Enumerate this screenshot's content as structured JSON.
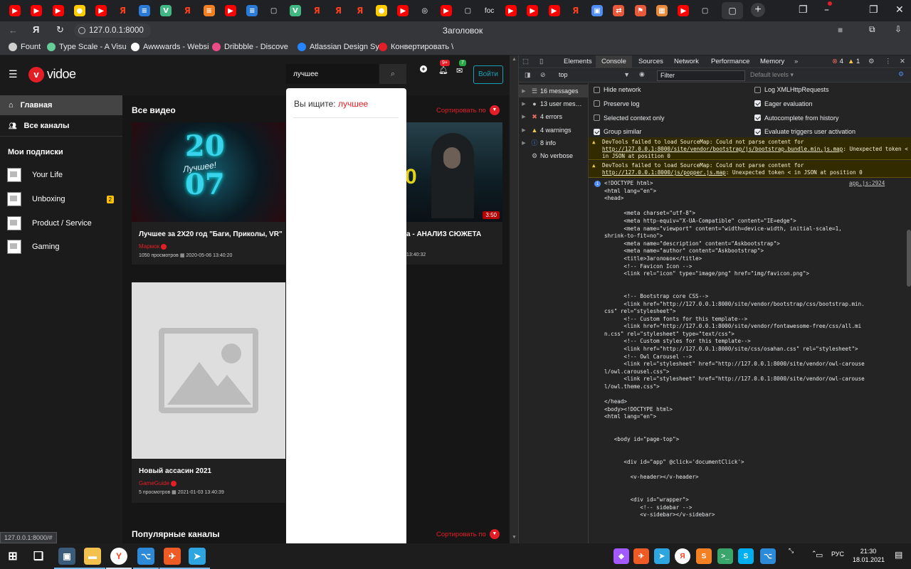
{
  "browser": {
    "window_title": "Заголовок",
    "url": "127.0.0.1:8000",
    "tabs": [
      {
        "icon": "youtube-icon",
        "color": "#ff0000"
      },
      {
        "icon": "youtube-icon",
        "color": "#ff0000"
      },
      {
        "icon": "youtube-icon",
        "color": "#ff0000"
      },
      {
        "icon": "yandex-music-icon",
        "color": "#ffcc00"
      },
      {
        "icon": "youtube-icon",
        "color": "#ff0000"
      },
      {
        "icon": "yandex-icon",
        "color": "#fc3f1d"
      },
      {
        "icon": "stackoverflow-icon",
        "color": "#2b7bd6"
      },
      {
        "icon": "vue-icon",
        "color": "#41b883"
      },
      {
        "icon": "yandex-icon",
        "color": "#fc3f1d"
      },
      {
        "icon": "stackoverflow-icon",
        "color": "#f48024"
      },
      {
        "icon": "youtube-icon",
        "color": "#ff0000"
      },
      {
        "icon": "stackoverflow-icon",
        "color": "#2b7bd6"
      },
      {
        "icon": "page-icon",
        "color": "#e8eaed"
      },
      {
        "icon": "vue-icon",
        "color": "#41b883"
      },
      {
        "icon": "yandex-icon",
        "color": "#fc3f1d"
      },
      {
        "icon": "yandex-icon",
        "color": "#fc3f1d"
      },
      {
        "icon": "yandex-icon",
        "color": "#fc3f1d"
      },
      {
        "icon": "yandex-music-icon",
        "color": "#ffcc00"
      },
      {
        "icon": "youtube-icon",
        "color": "#ff0000"
      },
      {
        "icon": "github-icon",
        "color": "#ffffff"
      },
      {
        "icon": "youtube-icon",
        "color": "#ff0000"
      },
      {
        "icon": "page-icon",
        "color": "#e8eaed"
      },
      {
        "icon": "foc-text",
        "color": "#e8eaed",
        "text": "foc"
      },
      {
        "icon": "youtube-icon",
        "color": "#ff0000"
      },
      {
        "icon": "youtube-icon",
        "color": "#ff0000"
      },
      {
        "icon": "youtube-icon",
        "color": "#ff0000"
      },
      {
        "icon": "yandex-icon",
        "color": "#fc3f1d"
      },
      {
        "icon": "chat-icon",
        "color": "#4e8cf7"
      },
      {
        "icon": "translate-icon",
        "color": "#e8593b"
      },
      {
        "icon": "flag-icon",
        "color": "#e8593b"
      },
      {
        "icon": "image-icon",
        "color": "#e88a3b"
      },
      {
        "icon": "youtube-icon",
        "color": "#ff0000"
      },
      {
        "icon": "page-icon",
        "color": "#e8eaed"
      }
    ],
    "bookmarks": [
      {
        "label": "Fount",
        "color": "#d0d0d0"
      },
      {
        "label": "Type Scale - A Visu",
        "color": "#6c9"
      },
      {
        "label": "Awwwards - Websi",
        "color": "#fff"
      },
      {
        "label": "Dribbble - Discove",
        "color": "#ea4c89"
      },
      {
        "label": "Atlassian Design Sy",
        "color": "#2684ff"
      },
      {
        "label": "Конвертировать \\",
        "color": "#e41e26"
      }
    ]
  },
  "site": {
    "logo_text": "vidoe",
    "search_value": "лучшее",
    "login_label": "Войти",
    "notif_badge_1": "9+",
    "notif_badge_2": "7",
    "nav": [
      {
        "label": "Главная",
        "icon": "home-icon",
        "active": true
      },
      {
        "label": "Все каналы",
        "icon": "users-icon",
        "active": false
      }
    ],
    "subs_heading": "Мои подписки",
    "subscriptions": [
      {
        "label": "Your Life",
        "badge": ""
      },
      {
        "label": "Unboxing",
        "badge": "2"
      },
      {
        "label": "Product / Service",
        "badge": ""
      },
      {
        "label": "Gaming",
        "badge": ""
      }
    ],
    "all_videos_heading": "Все видео",
    "sort_label": "Сортировать по",
    "popular_channels_heading": "Популярные каналы",
    "sort_label_2": "Сортировать по",
    "videos": [
      {
        "title": "Лучшее за 2Х20 год \"Баги, Приколы, VR\"",
        "channel": "Мармок",
        "views": "1050 просмотров",
        "date": "2020-05-06 13:40:20",
        "duration": ""
      },
      {
        "title": "а - АНАЛИЗ СЮЖЕТА",
        "channel": "",
        "views": "",
        "date": "13:40:32",
        "duration": "3:50"
      },
      {
        "title": "Новый ассасин 2021",
        "channel": "GameGuide",
        "views": "5 просмотров",
        "date": "2021-01-03 13:40:39",
        "duration": ""
      }
    ],
    "dropdown": {
      "prefix": "Вы ищите:",
      "query": "лучшее"
    },
    "status_url": "127.0.0.1:8000/#"
  },
  "devtools": {
    "tabs": [
      "Elements",
      "Console",
      "Sources",
      "Network",
      "Performance",
      "Memory"
    ],
    "active_tab": "Console",
    "error_count": "4",
    "warning_count": "1",
    "context": "top",
    "filter_placeholder": "Filter",
    "levels_label": "Default levels",
    "sidebar": [
      {
        "label": "16 messages",
        "icon": "list-icon",
        "color": "#bdc1c6"
      },
      {
        "label": "13 user mes…",
        "icon": "user-icon",
        "color": "#bdc1c6"
      },
      {
        "label": "4 errors",
        "icon": "error-icon",
        "color": "#e46962"
      },
      {
        "label": "4 warnings",
        "icon": "warning-icon",
        "color": "#f2c94c"
      },
      {
        "label": "8 info",
        "icon": "info-icon",
        "color": "#4e8cf7"
      },
      {
        "label": "No verbose",
        "icon": "gear-icon",
        "color": "#bdc1c6"
      }
    ],
    "settings_left": [
      {
        "label": "Hide network",
        "checked": false
      },
      {
        "label": "Preserve log",
        "checked": false
      },
      {
        "label": "Selected context only",
        "checked": false
      },
      {
        "label": "Group similar",
        "checked": true
      }
    ],
    "settings_right": [
      {
        "label": "Log XMLHttpRequests",
        "checked": false
      },
      {
        "label": "Eager evaluation",
        "checked": true
      },
      {
        "label": "Autocomplete from history",
        "checked": true
      },
      {
        "label": "Evaluate triggers user activation",
        "checked": true
      }
    ],
    "warnings": [
      {
        "pre": "DevTools failed to load SourceMap: Could not parse content for ",
        "link": "http://127.0.0.1:8000/site/vendor/bootstrap/js/bootstrap.bundle.min.js.map",
        "post": ": Unexpected token < in JSON at position 0"
      },
      {
        "pre": "DevTools failed to load SourceMap: Could not parse content for ",
        "link": "http://127.0.0.1:8000/js/popper.js.map",
        "post": ": Unexpected token < in JSON at position 0"
      }
    ],
    "source_ref": "app.js:2924",
    "code": "<!DOCTYPE html>\n<html lang=\"en\">\n<head>\n\n      <meta charset=\"utf-8\">\n      <meta http-equiv=\"X-UA-Compatible\" content=\"IE=edge\">\n      <meta name=\"viewport\" content=\"width=device-width, initial-scale=1,\nshrink-to-fit=no\">\n      <meta name=\"description\" content=\"Askbootstrap\">\n      <meta name=\"author\" content=\"Askbootstrap\">\n      <title>Заголовок</title>\n      <!-- Favicon Icon -->\n      <link rel=\"icon\" type=\"image/png\" href=\"img/favicon.png\">\n\n\n      <!-- Bootstrap core CSS-->\n      <link href=\"http://127.0.0.1:8000/site/vendor/bootstrap/css/bootstrap.min.\ncss\" rel=\"stylesheet\">\n      <!-- Custom fonts for this template-->\n      <link href=\"http://127.0.0.1:8000/site/vendor/fontawesome-free/css/all.mi\nn.css\" rel=\"stylesheet\" type=\"text/css\">\n      <!-- Custom styles for this template-->\n      <link href=\"http://127.0.0.1:8000/site/css/osahan.css\" rel=\"stylesheet\">\n      <!-- Owl Carousel -->\n      <link rel=\"stylesheet\" href=\"http://127.0.0.1:8000/site/vendor/owl-carouse\nl/owl.carousel.css\">\n      <link rel=\"stylesheet\" href=\"http://127.0.0.1:8000/site/vendor/owl-carouse\nl/owl.theme.css\">\n\n</head>\n<body><!DOCTYPE html>\n<html lang=\"en\">\n\n\n   <body id=\"page-top\">\n\n\n      <div id=\"app\" @click='documentClick'>\n\n        <v-header></v-header>\n\n\n        <div id=\"wrapper\">\n           <!-- sidebar -->\n           <v-sidebar></v-sidebar>"
  },
  "taskbar": {
    "time": "21:30",
    "date": "18.01.2021",
    "lang": "РУС",
    "apps": [
      {
        "icon": "start-icon",
        "color": "#ffffff"
      },
      {
        "icon": "task-view-icon",
        "color": "#ffffff"
      },
      {
        "icon": "cmd-icon",
        "color": "#3b5b7a"
      },
      {
        "icon": "explorer-icon",
        "color": "#f2c14e"
      },
      {
        "icon": "yandex-browser-icon",
        "color": "#fc3f1d"
      },
      {
        "icon": "vscode-icon",
        "color": "#2c8ad8"
      },
      {
        "icon": "postman-icon",
        "color": "#ef5b25"
      },
      {
        "icon": "telegram-icon",
        "color": "#2ca5e0"
      }
    ],
    "tray": [
      {
        "icon": "figma-icon",
        "color": "#a259ff"
      },
      {
        "icon": "postman-icon",
        "color": "#ef5b25"
      },
      {
        "icon": "telegram-icon",
        "color": "#2ca5e0"
      },
      {
        "icon": "yandex-icon",
        "color": "#fc3f1d"
      },
      {
        "icon": "sublime-icon",
        "color": "#f48024"
      },
      {
        "icon": "terminal-icon",
        "color": "#3aa56b"
      },
      {
        "icon": "skype-icon",
        "color": "#00aff0"
      },
      {
        "icon": "vscode-icon",
        "color": "#2c8ad8"
      }
    ]
  }
}
